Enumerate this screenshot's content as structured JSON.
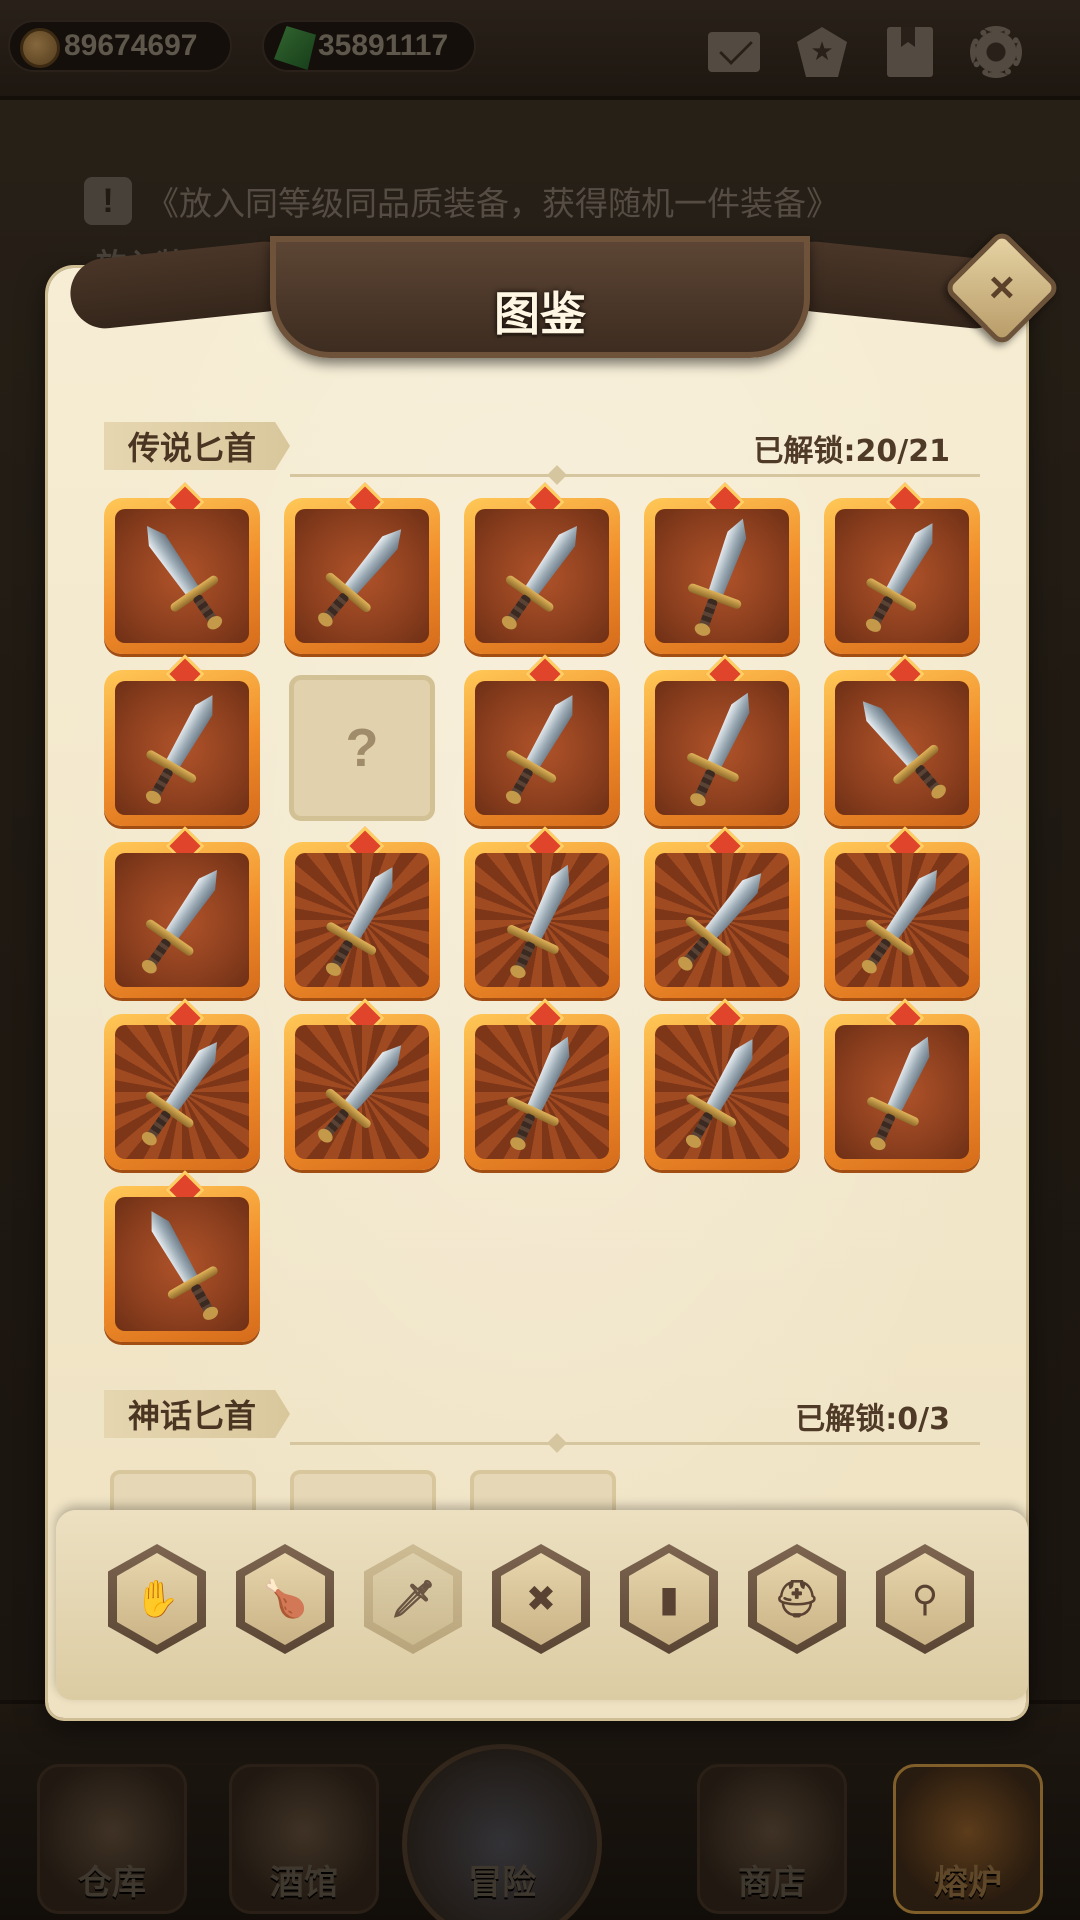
{
  "currencies": {
    "gold": "89674697",
    "gems": "35891117"
  },
  "top_icons": [
    "mail-icon",
    "star-badge-icon",
    "book-icon",
    "gear-icon"
  ],
  "hint": {
    "icon": "!",
    "text": "《放入同等级同品质装备，获得随机一件装备》"
  },
  "bg_label": "放入装备",
  "panel": {
    "title": "图鉴",
    "close_label": "×"
  },
  "sections": [
    {
      "title": "传说匕首",
      "count": "已解锁:20/21"
    },
    {
      "title": "神话匕首",
      "count": "已解锁:0/3"
    }
  ],
  "legendary_grid": {
    "total_slots": 21,
    "locked_slot_index": 6,
    "locked_label": "?",
    "ray_background_slots": [
      11,
      12,
      13,
      14,
      15,
      16,
      17,
      18
    ]
  },
  "mythic_grid": {
    "visible_slots": 3
  },
  "category_tabs": [
    {
      "name": "armor-icon",
      "glyph": "✋"
    },
    {
      "name": "drumstick-icon",
      "glyph": "🍗"
    },
    {
      "name": "dagger-icon",
      "glyph": "🗡",
      "active": true
    },
    {
      "name": "shield-cross-icon",
      "glyph": "✖"
    },
    {
      "name": "book-icon",
      "glyph": "▮"
    },
    {
      "name": "helmet-icon",
      "glyph": "⛑"
    },
    {
      "name": "necklace-icon",
      "glyph": "⚲"
    }
  ],
  "bottom_nav": [
    {
      "label": "仓库"
    },
    {
      "label": "酒馆"
    },
    {
      "label": "冒险"
    },
    {
      "label": "商店"
    },
    {
      "label": "熔炉",
      "active": true
    }
  ],
  "colors": {
    "frame_legendary": "#f08d2a",
    "panel_bg": "#f6edd4",
    "banner": "#4a3628"
  }
}
